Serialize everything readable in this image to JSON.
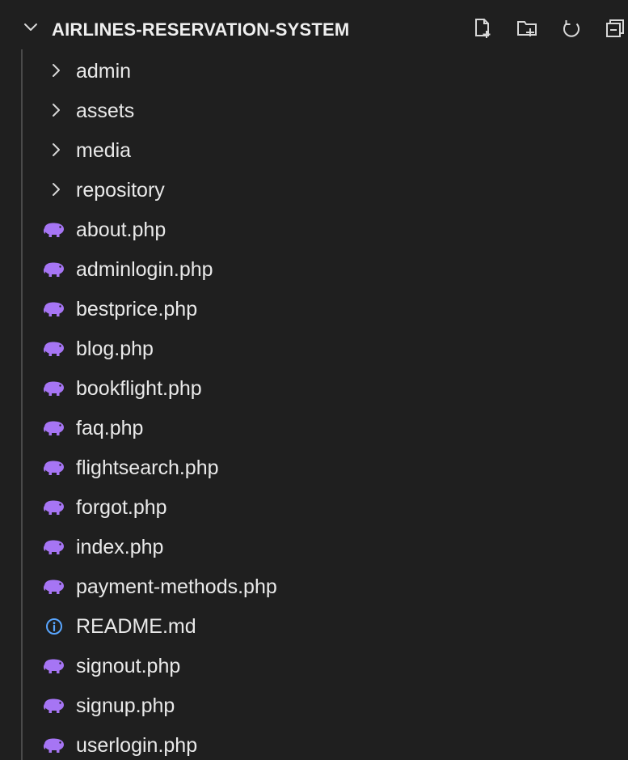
{
  "explorer": {
    "title": "AIRLINES-RESERVATION-SYSTEM",
    "actions": [
      {
        "name": "new-file-icon"
      },
      {
        "name": "new-folder-icon"
      },
      {
        "name": "refresh-icon"
      },
      {
        "name": "collapse-all-icon"
      }
    ],
    "folders": [
      {
        "label": "admin",
        "icon": "chevron-right-icon"
      },
      {
        "label": "assets",
        "icon": "chevron-right-icon"
      },
      {
        "label": "media",
        "icon": "chevron-right-icon"
      },
      {
        "label": "repository",
        "icon": "chevron-right-icon"
      }
    ],
    "files": [
      {
        "label": "about.php",
        "icon": "php-elephant-icon"
      },
      {
        "label": "adminlogin.php",
        "icon": "php-elephant-icon"
      },
      {
        "label": "bestprice.php",
        "icon": "php-elephant-icon"
      },
      {
        "label": "blog.php",
        "icon": "php-elephant-icon"
      },
      {
        "label": "bookflight.php",
        "icon": "php-elephant-icon"
      },
      {
        "label": "faq.php",
        "icon": "php-elephant-icon"
      },
      {
        "label": "flightsearch.php",
        "icon": "php-elephant-icon"
      },
      {
        "label": "forgot.php",
        "icon": "php-elephant-icon"
      },
      {
        "label": "index.php",
        "icon": "php-elephant-icon"
      },
      {
        "label": "payment-methods.php",
        "icon": "php-elephant-icon"
      },
      {
        "label": "README.md",
        "icon": "info-icon"
      },
      {
        "label": "signout.php",
        "icon": "php-elephant-icon"
      },
      {
        "label": "signup.php",
        "icon": "php-elephant-icon"
      },
      {
        "label": "userlogin.php",
        "icon": "php-elephant-icon"
      }
    ],
    "colors": {
      "background": "#1f1f1f",
      "text": "#e9e9e9",
      "php_icon": "#a675f4",
      "info_icon": "#59a6ff",
      "guide": "#4a4a4a"
    }
  }
}
